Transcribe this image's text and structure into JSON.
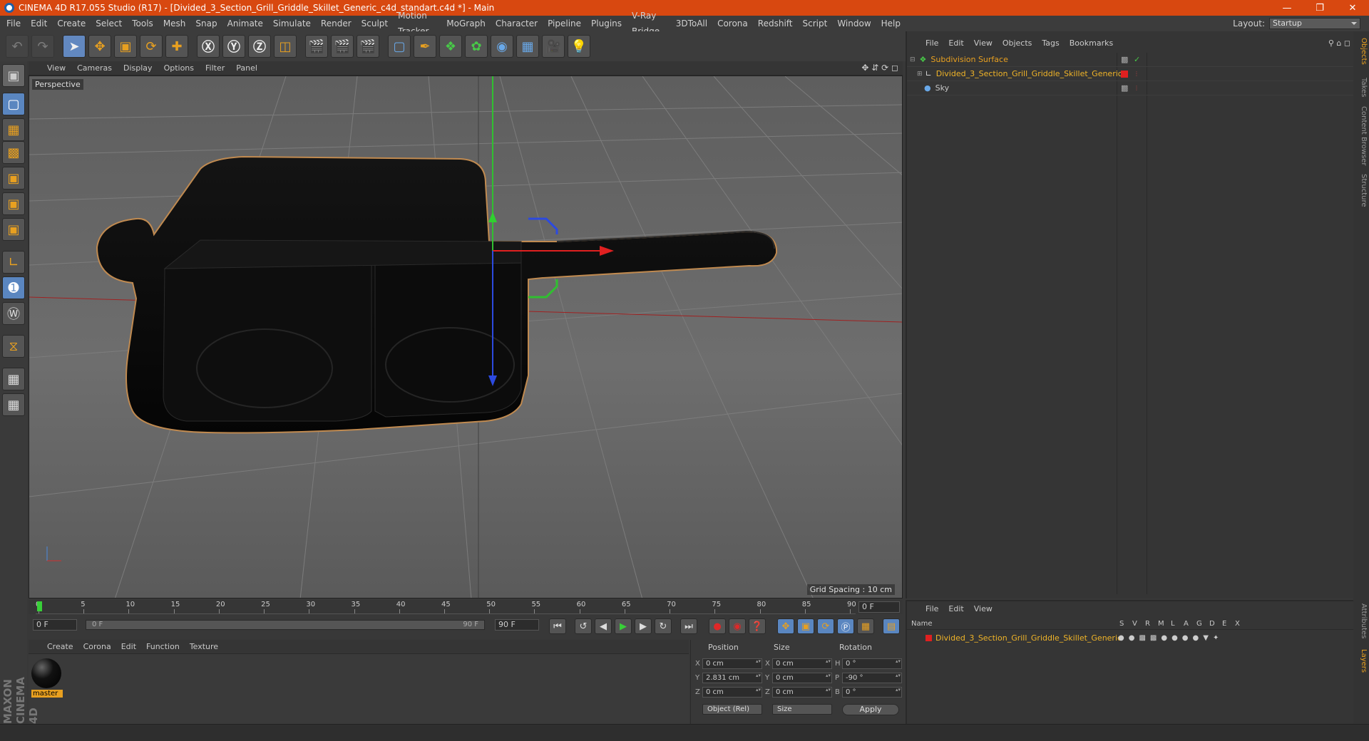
{
  "title": "CINEMA 4D R17.055 Studio (R17) - [Divided_3_Section_Grill_Griddle_Skillet_Generic_c4d_standart.c4d *] - Main",
  "menu": [
    "File",
    "Edit",
    "Create",
    "Select",
    "Tools",
    "Mesh",
    "Snap",
    "Animate",
    "Simulate",
    "Render",
    "Sculpt",
    "Motion Tracker",
    "MoGraph",
    "Character",
    "Pipeline",
    "Plugins",
    "V-Ray Bridge",
    "3DToAll",
    "Corona",
    "Redshift",
    "Script",
    "Window",
    "Help"
  ],
  "layout": {
    "label": "Layout:",
    "value": "Startup"
  },
  "viewport": {
    "menu": [
      "View",
      "Cameras",
      "Display",
      "Options",
      "Filter",
      "Panel"
    ],
    "label": "Perspective",
    "grid_spacing": "Grid Spacing : 10 cm"
  },
  "timeline": {
    "ticks": [
      "0",
      "5",
      "10",
      "15",
      "20",
      "25",
      "30",
      "35",
      "40",
      "45",
      "50",
      "55",
      "60",
      "65",
      "70",
      "75",
      "80",
      "85",
      "90"
    ],
    "current_frame": "0 F"
  },
  "anim": {
    "start": "0 F",
    "scrub_start": "0 F",
    "scrub_end": "90 F",
    "end": "90 F"
  },
  "material": {
    "menu": [
      "Create",
      "Corona",
      "Edit",
      "Function",
      "Texture"
    ],
    "items": [
      {
        "name": "master"
      }
    ]
  },
  "coords": {
    "headers": {
      "position": "Position",
      "size": "Size",
      "rotation": "Rotation"
    },
    "rows": [
      {
        "axis": "X",
        "pos": "0 cm",
        "saxis": "X",
        "size": "0 cm",
        "raxis": "H",
        "rot": "0 °"
      },
      {
        "axis": "Y",
        "pos": "2.831 cm",
        "saxis": "Y",
        "size": "0 cm",
        "raxis": "P",
        "rot": "-90 °"
      },
      {
        "axis": "Z",
        "pos": "0 cm",
        "saxis": "Z",
        "size": "0 cm",
        "raxis": "B",
        "rot": "0 °"
      }
    ],
    "mode": "Object (Rel)",
    "size_mode": "Size",
    "apply": "Apply"
  },
  "objects": {
    "menu": [
      "File",
      "Edit",
      "View",
      "Objects",
      "Tags",
      "Bookmarks"
    ],
    "items": [
      {
        "name": "Subdivision Surface",
        "color": "#e8a020"
      },
      {
        "name": "Divided_3_Section_Grill_Griddle_Skillet_Generic",
        "color": "#f0b428"
      },
      {
        "name": "Sky",
        "color": "#c8c8c8"
      }
    ]
  },
  "layers": {
    "menu": [
      "File",
      "Edit",
      "View"
    ],
    "columns": [
      "Name",
      "S",
      "V",
      "R",
      "M",
      "L",
      "A",
      "G",
      "D",
      "E",
      "X"
    ],
    "items": [
      {
        "name": "Divided_3_Section_Grill_Griddle_Skillet_Generic"
      }
    ]
  },
  "side_tabs": [
    "Objects",
    "Takes",
    "Content Browser",
    "Structure",
    "Attributes",
    "Layers"
  ],
  "brand": "MAXON CINEMA 4D"
}
